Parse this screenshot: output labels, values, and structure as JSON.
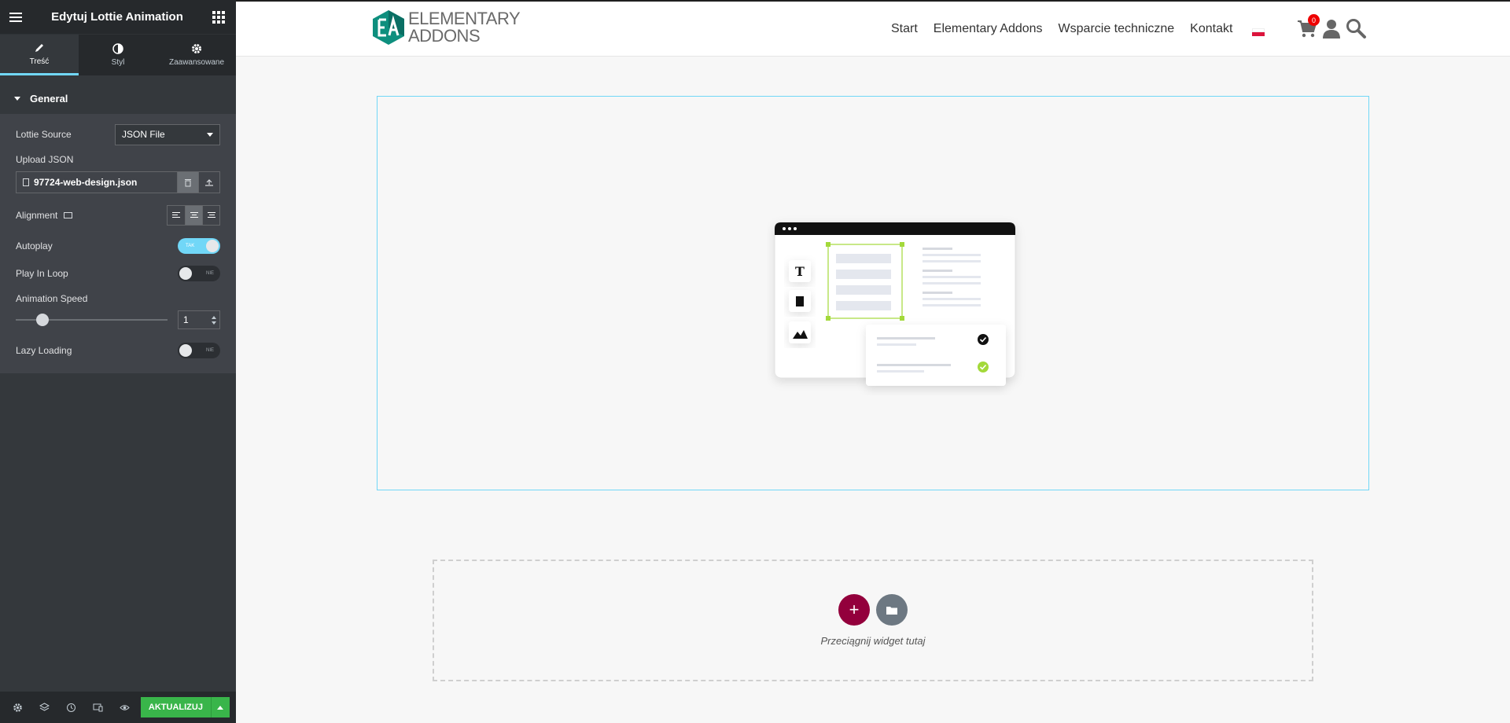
{
  "panel": {
    "title": "Edytuj Lottie Animation",
    "tabs": [
      {
        "label": "Treść",
        "icon": "pencil-icon",
        "active": true
      },
      {
        "label": "Styl",
        "icon": "contrast-icon",
        "active": false
      },
      {
        "label": "Zaawansowane",
        "icon": "gear-icon",
        "active": false
      }
    ],
    "section": "General",
    "controls": {
      "source_label": "Lottie Source",
      "source_value": "JSON File",
      "upload_label": "Upload JSON",
      "upload_file": "97724-web-design.json",
      "alignment_label": "Alignment",
      "alignment_value": "center",
      "autoplay_label": "Autoplay",
      "autoplay_state": "TAK",
      "loop_label": "Play In Loop",
      "loop_state": "NIE",
      "speed_label": "Animation Speed",
      "speed_value": "1",
      "lazy_label": "Lazy Loading",
      "lazy_state": "NIE"
    },
    "footer": {
      "update_label": "AKTUALIZUJ",
      "icons": [
        "settings-icon",
        "layers-icon",
        "history-icon",
        "responsive-icon",
        "preview-eye-icon"
      ]
    }
  },
  "site": {
    "logo_line1": "ELEMENTARY",
    "logo_line2": "ADDONS",
    "nav": [
      "Start",
      "Elementary Addons",
      "Wsparcie techniczne",
      "Kontakt"
    ],
    "cart_count": "0",
    "colors": {
      "accent": "#71d7f7",
      "brand": "#0e8f7e",
      "add_button": "#93003c",
      "update_button": "#39b54a"
    }
  },
  "drop_zone": {
    "text": "Przeciągnij widget tutaj"
  }
}
